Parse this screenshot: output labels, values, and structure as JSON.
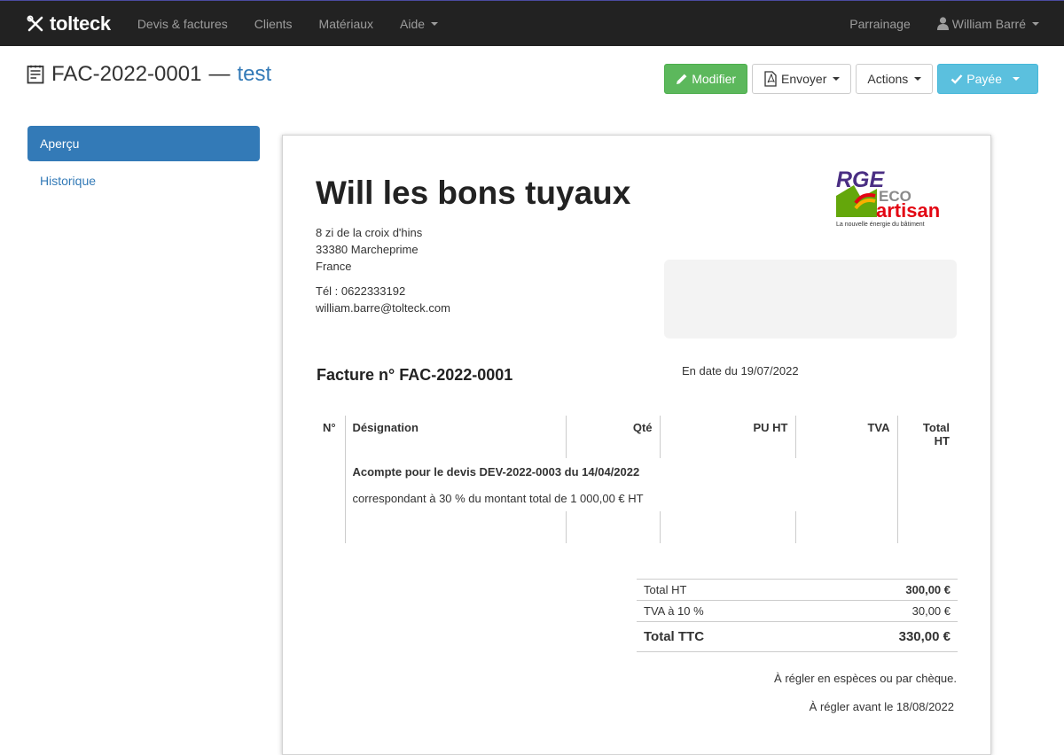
{
  "nav": {
    "brand": "tolteck",
    "items": [
      "Devis & factures",
      "Clients",
      "Matériaux",
      "Aide"
    ],
    "sponsor": "Parrainage",
    "user": "William Barré"
  },
  "header": {
    "doc_number": "FAC-2022-0001",
    "separator": "—",
    "doc_name": "test"
  },
  "actions": {
    "edit": "Modifier",
    "send": "Envoyer",
    "more": "Actions",
    "status": "Payée"
  },
  "sidebar": {
    "items": [
      {
        "label": "Aperçu"
      },
      {
        "label": "Historique"
      }
    ]
  },
  "document": {
    "company": "Will les bons tuyaux",
    "address": [
      "8 zi de la croix d'hins",
      "33380 Marcheprime",
      "France"
    ],
    "phone": "Tél : 0622333192",
    "email": "william.barre@tolteck.com",
    "logo": {
      "rge": "RGE",
      "eco": "ECO",
      "artisan": "artisan",
      "tagline": "La nouvelle énergie du bâtiment"
    },
    "invoice_title": "Facture n° FAC-2022-0001",
    "invoice_date": "En date du 19/07/2022",
    "columns": [
      "N°",
      "Désignation",
      "Qté",
      "PU HT",
      "TVA",
      "Total HT"
    ],
    "line_title": "Acompte pour le devis DEV-2022-0003 du 14/04/2022",
    "line_desc": "correspondant à 30 % du montant total de 1 000,00 € HT",
    "totals": {
      "ht_label": "Total HT",
      "ht_value": "300,00 €",
      "tva_label": "TVA à 10 %",
      "tva_value": "30,00 €",
      "ttc_label": "Total TTC",
      "ttc_value": "330,00 €"
    },
    "payment_method": "À régler en espèces ou par chèque.",
    "payment_due": "À régler avant le 18/08/2022"
  }
}
